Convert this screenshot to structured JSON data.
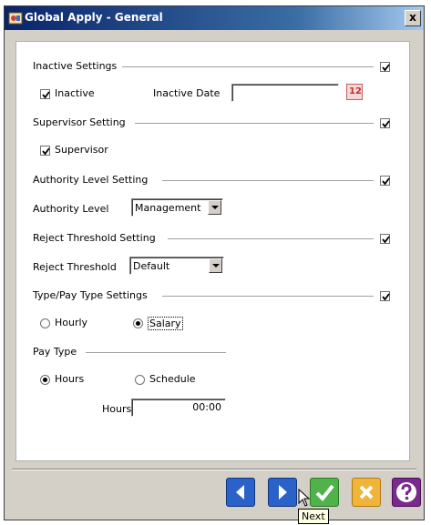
{
  "window": {
    "title": "Global Apply - General",
    "close_label": "x"
  },
  "inactive": {
    "section_label": "Inactive Settings",
    "section_checked": true,
    "checkbox_label": "Inactive",
    "checkbox_checked": true,
    "date_label": "Inactive Date",
    "date_value": "",
    "calendar_icon_label": "12"
  },
  "supervisor": {
    "section_label": "Supervisor Setting",
    "section_checked": true,
    "checkbox_label": "Supervisor",
    "checkbox_checked": true
  },
  "authority": {
    "section_label": "Authority Level Setting",
    "section_checked": true,
    "field_label": "Authority Level",
    "selected": "Management"
  },
  "reject": {
    "section_label": "Reject Threshold Setting",
    "section_checked": true,
    "field_label": "Reject Threshold",
    "selected": "Default"
  },
  "pay_type_settings": {
    "section_label": "Type/Pay Type Settings",
    "section_checked": true,
    "option_hourly": "Hourly",
    "option_salary": "Salary",
    "selected": "Salary"
  },
  "pay_type": {
    "group_label": "Pay Type",
    "option_hours": "Hours",
    "option_schedule": "Schedule",
    "selected": "Hours",
    "hours_label": "Hours",
    "hours_value": "00:00"
  },
  "footer": {
    "tooltip": "Next",
    "colors": {
      "blue": "#2a62c9",
      "green": "#4fb34a",
      "yellow": "#f0b43a",
      "help_purple": "#7a2a8c"
    }
  }
}
